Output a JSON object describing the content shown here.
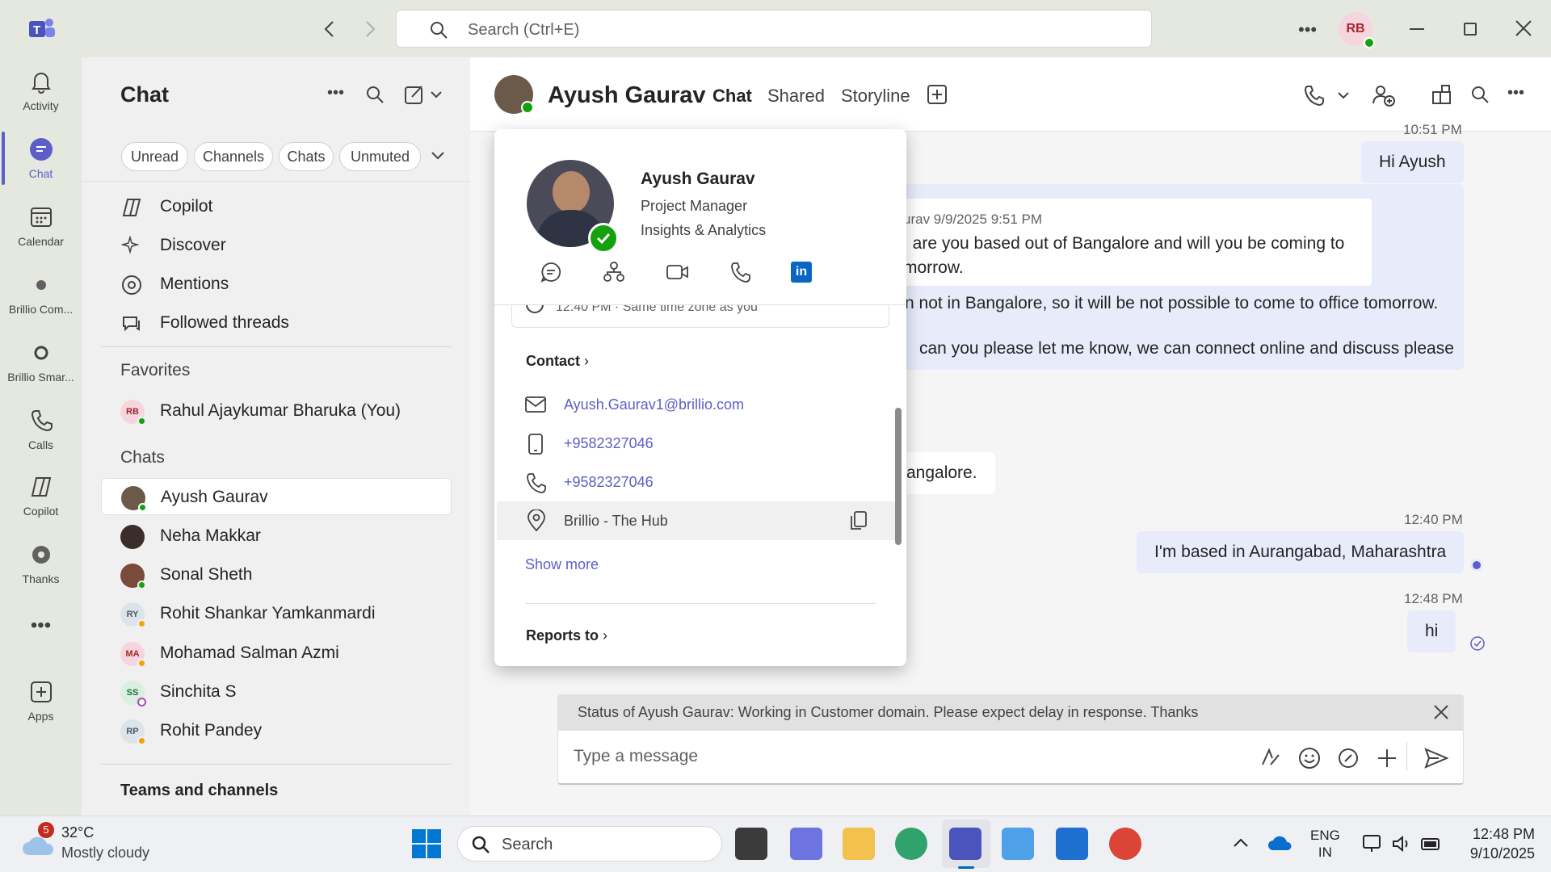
{
  "titlebar": {
    "search_placeholder": "Search (Ctrl+E)",
    "user_initials": "RB"
  },
  "rail": [
    {
      "label": "Activity",
      "icon": "bell-icon"
    },
    {
      "label": "Chat",
      "icon": "chat-icon"
    },
    {
      "label": "Calendar",
      "icon": "calendar-icon"
    },
    {
      "label": "Brillio Com...",
      "icon": "app-icon"
    },
    {
      "label": "Brillio Smar...",
      "icon": "app-icon"
    },
    {
      "label": "Calls",
      "icon": "phone-icon"
    },
    {
      "label": "Copilot",
      "icon": "copilot-icon"
    },
    {
      "label": "Thanks",
      "icon": "gear-icon"
    },
    {
      "label": "Apps",
      "icon": "plus-icon"
    }
  ],
  "leftpane": {
    "title": "Chat",
    "filters": [
      "Unread",
      "Channels",
      "Chats",
      "Unmuted"
    ],
    "quick": [
      "Copilot",
      "Discover",
      "Mentions",
      "Followed threads"
    ],
    "favorites_header": "Favorites",
    "favorites": [
      {
        "name": "Rahul Ajaykumar Bharuka (You)",
        "initials": "RB"
      }
    ],
    "chats_header": "Chats",
    "chats": [
      {
        "name": "Ayush Gaurav",
        "initials": ""
      },
      {
        "name": "Neha Makkar",
        "initials": ""
      },
      {
        "name": "Sonal Sheth",
        "initials": ""
      },
      {
        "name": "Rohit Shankar Yamkanmardi",
        "initials": "RY"
      },
      {
        "name": "Mohamad Salman Azmi",
        "initials": "MA"
      },
      {
        "name": "Sinchita S",
        "initials": "SS"
      },
      {
        "name": "Rohit Pandey",
        "initials": "RP"
      }
    ],
    "teams_header": "Teams and channels"
  },
  "header": {
    "name": "Ayush Gaurav",
    "tabs": [
      "Chat",
      "Shared",
      "Storyline"
    ]
  },
  "messages": {
    "top_time": "10:51 PM",
    "hi_ayush": "Hi Ayush",
    "quote_meta": "urav  9/9/2025 9:51 PM",
    "quote_line1": ", are you based out of Bangalore and will you be coming to",
    "quote_line2": "morrow.",
    "reply1": "n not in Bangalore, so it will be not possible to come to office tomorrow.",
    "reply2": "can you please let me know, we can connect online and discuss please",
    "in_msg": "angalore.",
    "t1": "12:40 PM",
    "m1": "I'm based in Aurangabad, Maharashtra",
    "t2": "12:48 PM",
    "m2": "hi"
  },
  "status_banner": "Status of Ayush Gaurav: Working in Customer domain. Please expect delay in response. Thanks",
  "compose_placeholder": "Type a message",
  "card": {
    "name": "Ayush Gaurav",
    "title": "Project Manager",
    "dept": "Insights & Analytics",
    "timezone": "12:40 PM · Same time zone as you",
    "contact_header": "Contact",
    "email": "Ayush.Gaurav1@brillio.com",
    "mobile": "+9582327046",
    "phone": "+9582327046",
    "location": "Brillio - The Hub",
    "show_more": "Show more",
    "reports_to": "Reports to"
  },
  "taskbar": {
    "weather_badge": "5",
    "temp": "32°C",
    "weather": "Mostly cloudy",
    "search": "Search",
    "lang1": "ENG",
    "lang2": "IN",
    "time": "12:48 PM",
    "date": "9/10/2025"
  }
}
